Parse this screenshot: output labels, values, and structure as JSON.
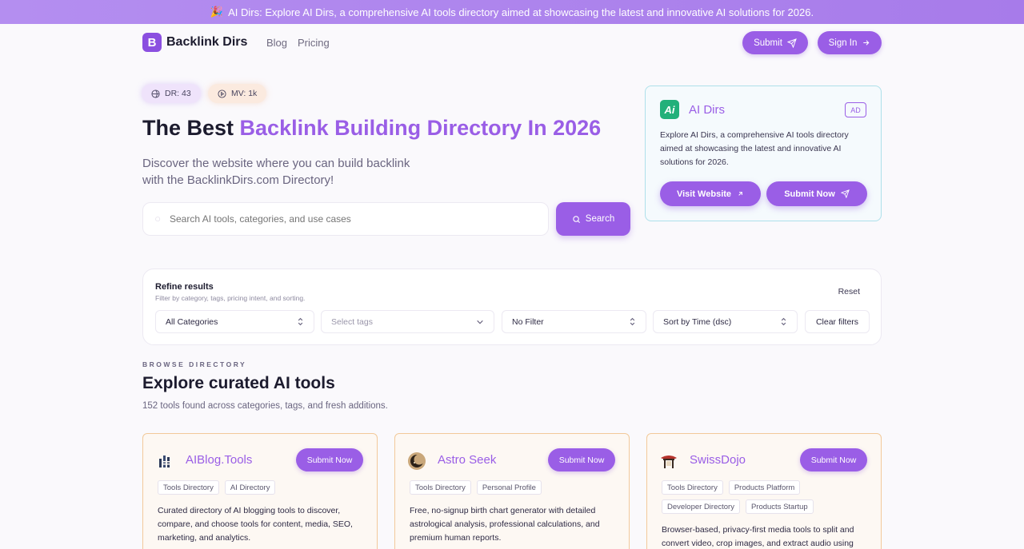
{
  "banner": {
    "icon": "party-icon",
    "text": "AI Dirs: Explore AI Dirs, a comprehensive AI tools directory aimed at showcasing the latest and innovative AI solutions for 2026."
  },
  "nav": {
    "brand": "Backlink Dirs",
    "links": [
      "Blog",
      "Pricing"
    ],
    "submit_label": "Submit",
    "signin_label": "Sign In"
  },
  "hero": {
    "chips": [
      {
        "label": "DR: 43",
        "icon": "globe-icon"
      },
      {
        "label": "MV: 1k",
        "icon": "play-icon"
      }
    ],
    "title_prefix": "The Best",
    "title_accent": "Backlink Building Directory In 2026",
    "subtitle": "Discover the website where you can build backlink with the BacklinkDirs.com Directory!",
    "search_placeholder": "Search AI tools, categories, and use cases",
    "search_label": "Search"
  },
  "ad": {
    "name": "AI Dirs",
    "badge": "AD",
    "description": "Explore AI Dirs, a comprehensive AI tools directory aimed at showcasing the latest and innovative AI solutions for 2026.",
    "visit_label": "Visit Website",
    "submit_label": "Submit Now"
  },
  "filters": {
    "title": "Refine results",
    "subtitle": "Filter by category, tags, pricing intent, and sorting.",
    "reset_label": "Reset",
    "category": "All Categories",
    "tags_placeholder": "Select tags",
    "pricing": "No Filter",
    "sort": "Sort by Time (dsc)",
    "clear_label": "Clear filters"
  },
  "directory": {
    "eyebrow": "BROWSE DIRECTORY",
    "title": "Explore curated AI tools",
    "subtitle": "152 tools found across categories, tags, and fresh additions."
  },
  "cards": [
    {
      "name": "AIBlog.Tools",
      "icon": "bars-logo-icon",
      "button": "Submit Now",
      "tags": [
        "Tools Directory",
        "AI Directory"
      ],
      "description": "Curated directory of AI blogging tools to discover, compare, and choose tools for content, media, SEO, marketing, and analytics."
    },
    {
      "name": "Astro Seek",
      "icon": "moon-logo-icon",
      "button": "Submit Now",
      "tags": [
        "Tools Directory",
        "Personal Profile"
      ],
      "description": "Free, no-signup birth chart generator with detailed astrological analysis, professional calculations, and premium human reports."
    },
    {
      "name": "SwissDojo",
      "icon": "dojo-logo-icon",
      "button": "Submit Now",
      "tags": [
        "Tools Directory",
        "Products Platform",
        "Developer Directory",
        "Products Startup"
      ],
      "description": "Browser-based, privacy-first media tools to split and convert video, crop images, and extract audio using"
    }
  ],
  "colors": {
    "accent": "#9a5ee6",
    "banner": "#b48ef0",
    "card_border": "#f2c99a",
    "ad_border": "#aee0ea"
  }
}
